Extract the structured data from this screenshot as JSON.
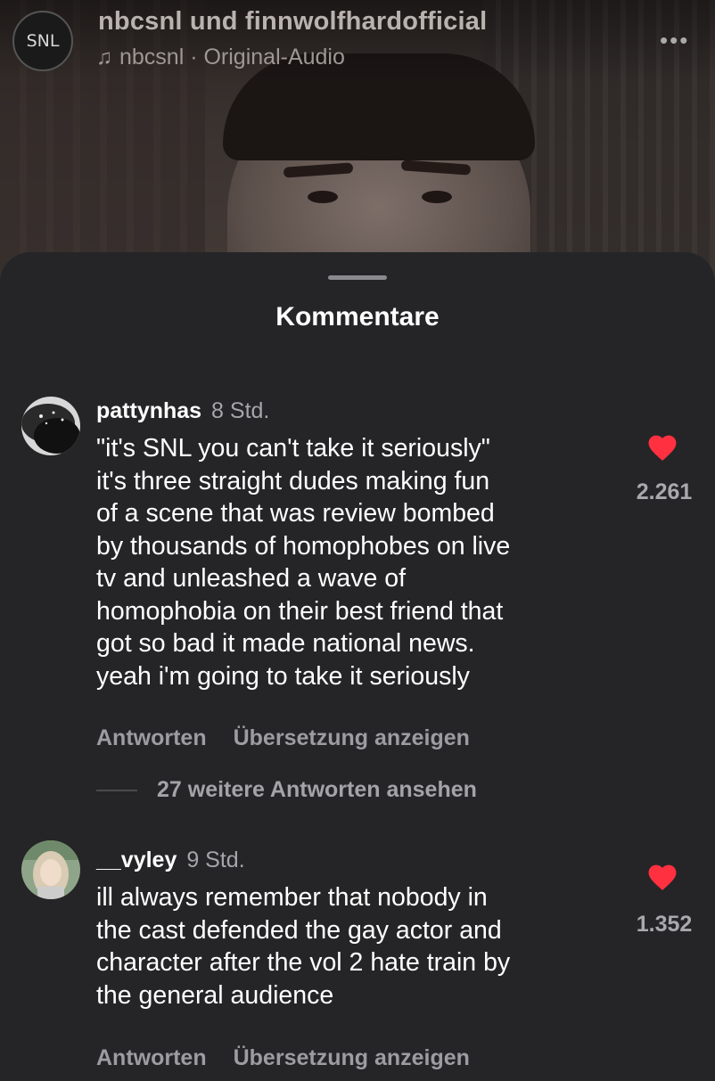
{
  "header": {
    "avatar_text": "SNL",
    "title": "nbcsnl und finnwolfhardofficial",
    "audio_icon": "music-note-icon",
    "audio_label": "nbcsnl · Original-Audio",
    "more_icon": "ellipsis-icon"
  },
  "sheet": {
    "title": "Kommentare"
  },
  "comments": [
    {
      "username": "pattynhas",
      "time": "8 Std.",
      "lines": [
        "\"it's SNL you can't take it seriously\"",
        "it's three straight dudes making fun",
        "of a scene that was review bombed",
        "by thousands of homophobes on live",
        "tv and unleashed a wave of",
        "homophobia on their best friend that",
        "got so bad it made national news.",
        "yeah i'm going to take it seriously"
      ],
      "likes": "2.261",
      "reply_label": "Antworten",
      "translate_label": "Übersetzung anzeigen",
      "more_replies": "27 weitere Antworten ansehen"
    },
    {
      "username": "__vyley",
      "time": "9 Std.",
      "lines": [
        "ill always remember that nobody in",
        "the cast defended the gay actor and",
        "character after the vol 2 hate train by",
        "the general audience"
      ],
      "likes": "1.352",
      "reply_label": "Antworten",
      "translate_label": "Übersetzung anzeigen"
    }
  ],
  "colors": {
    "sheet_bg": "#252527",
    "heart": "#ff3040",
    "secondary_text": "#a5a5aa"
  }
}
